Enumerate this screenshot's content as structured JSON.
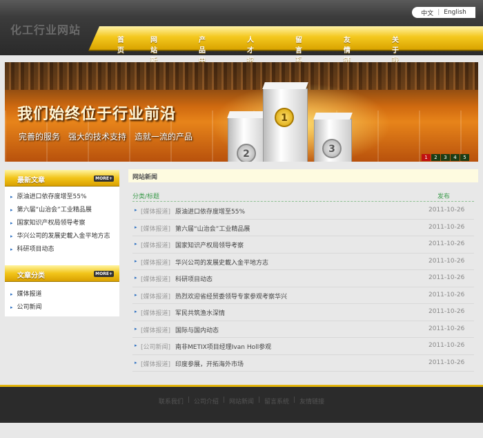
{
  "header": {
    "logo": "化工行业网站",
    "lang_cn": "中文",
    "lang_sep": "|",
    "lang_en": "English"
  },
  "nav": [
    {
      "label": "首页",
      "w": 46
    },
    {
      "label": "网站新闻",
      "w": 92
    },
    {
      "label": "产品中心",
      "w": 48
    },
    {
      "label": "人才招聘",
      "w": 92
    },
    {
      "label": "留言系统",
      "w": 48
    },
    {
      "label": "友情链接",
      "w": 90
    },
    {
      "label": "关于我们",
      "w": 48
    }
  ],
  "banner": {
    "headline": "我们始终位于行业前沿",
    "slogan": "完善的服务　强大的技术支持　造就一流的产品",
    "medal_1": "1",
    "medal_2": "2",
    "medal_3": "3",
    "pager": [
      "1",
      "2",
      "3",
      "4",
      "5"
    ],
    "pager_active": "1"
  },
  "sidebar": {
    "latest_title": "最新文章",
    "more": "MORE+",
    "latest": [
      "原油进口依存度增至55%",
      "第六届“山治会”工业精品展",
      "国家知识产权局领导考察",
      "华兴公司的发展史載入金平地方志",
      "科研项目动态"
    ],
    "cat_title": "文章分类",
    "categories": [
      "媒体报道",
      "公司新闻"
    ]
  },
  "main": {
    "title": "网站新闻",
    "col_title": "分类/标题",
    "col_date": "发布",
    "rows": [
      {
        "cat": "[媒体报道]",
        "title": "原油进口依存度增至55%",
        "date": "2011-10-26"
      },
      {
        "cat": "[媒体报道]",
        "title": "第六届“山治会”工业精品展",
        "date": "2011-10-26"
      },
      {
        "cat": "[媒体报道]",
        "title": "国家知识产权局领导考察",
        "date": "2011-10-26"
      },
      {
        "cat": "[媒体报道]",
        "title": "华兴公司的发展史載入金平地方志",
        "date": "2011-10-26"
      },
      {
        "cat": "[媒体报道]",
        "title": "科研项目动态",
        "date": "2011-10-26"
      },
      {
        "cat": "[媒体报道]",
        "title": "热烈欢迎省经贸委领导专家参观考察华兴",
        "date": "2011-10-26"
      },
      {
        "cat": "[媒体报道]",
        "title": "军民共筑渔水深情",
        "date": "2011-10-26"
      },
      {
        "cat": "[媒体报道]",
        "title": "国际与国内动态",
        "date": "2011-10-26"
      },
      {
        "cat": "[公司新闻]",
        "title": "南非METIX项目经理Ivan Holl参观",
        "date": "2011-10-26"
      },
      {
        "cat": "[媒体报道]",
        "title": "印度参展，开拓海外市场",
        "date": "2011-10-26"
      }
    ]
  },
  "footer": {
    "links": [
      "联系我们",
      "公司介绍",
      "网站新闻",
      "留言系统",
      "友情链接"
    ],
    "sep": "|"
  },
  "colors": {
    "accent": "#f2c51a",
    "header_dark": "#2a2a2a",
    "link_blue": "#2a6ec0",
    "green": "#3a9a4a"
  }
}
